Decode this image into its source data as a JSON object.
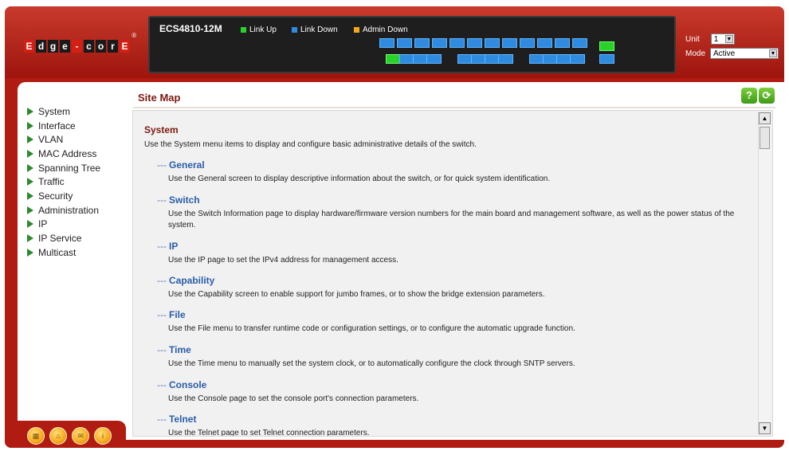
{
  "brand": {
    "logo_letters": [
      "E",
      "d",
      "g",
      "e",
      "-",
      "c",
      "o",
      "r",
      "E"
    ],
    "reg": "®"
  },
  "device": {
    "model": "ECS4810-12M",
    "legend": [
      {
        "label": "Link Up",
        "color": "#2bd12b"
      },
      {
        "label": "Link Down",
        "color": "#2e8be0"
      },
      {
        "label": "Admin Down",
        "color": "#f5a81c"
      }
    ]
  },
  "unit_select": {
    "label": "Unit",
    "value": "1"
  },
  "mode_select": {
    "label": "Mode",
    "value": "Active"
  },
  "sidebar": {
    "items": [
      {
        "label": "System"
      },
      {
        "label": "Interface"
      },
      {
        "label": "VLAN"
      },
      {
        "label": "MAC Address"
      },
      {
        "label": "Spanning Tree"
      },
      {
        "label": "Traffic"
      },
      {
        "label": "Security"
      },
      {
        "label": "Administration"
      },
      {
        "label": "IP"
      },
      {
        "label": "IP Service"
      },
      {
        "label": "Multicast"
      }
    ]
  },
  "page": {
    "title": "Site Map",
    "help_icon": "?",
    "refresh_icon": "refresh-icon"
  },
  "sitemap": {
    "section_title": "System",
    "section_desc": "Use the System menu items to display and configure basic administrative details of the switch.",
    "entries": [
      {
        "title": "General",
        "desc": "Use the General screen to display descriptive information about the switch, or for quick system identification."
      },
      {
        "title": "Switch",
        "desc": "Use the Switch Information page to display hardware/firmware version numbers for the main board and management software, as well as the power status of the system."
      },
      {
        "title": "IP",
        "desc": "Use the IP page to set the IPv4 address for management access."
      },
      {
        "title": "Capability",
        "desc": "Use the Capability screen to enable support for jumbo frames, or to show the bridge extension parameters."
      },
      {
        "title": "File",
        "desc": "Use the File menu to transfer runtime code or configuration settings, or to configure the automatic upgrade function."
      },
      {
        "title": "Time",
        "desc": "Use the Time menu to manually set the system clock, or to automatically configure the clock through SNTP servers."
      },
      {
        "title": "Console",
        "desc": "Use the Console page to set the console port's connection parameters."
      },
      {
        "title": "Telnet",
        "desc": "Use the Telnet page to set Telnet connection parameters."
      }
    ]
  },
  "bottom_icons": [
    "ports-icon",
    "home-icon",
    "mail-icon",
    "info-icon"
  ]
}
